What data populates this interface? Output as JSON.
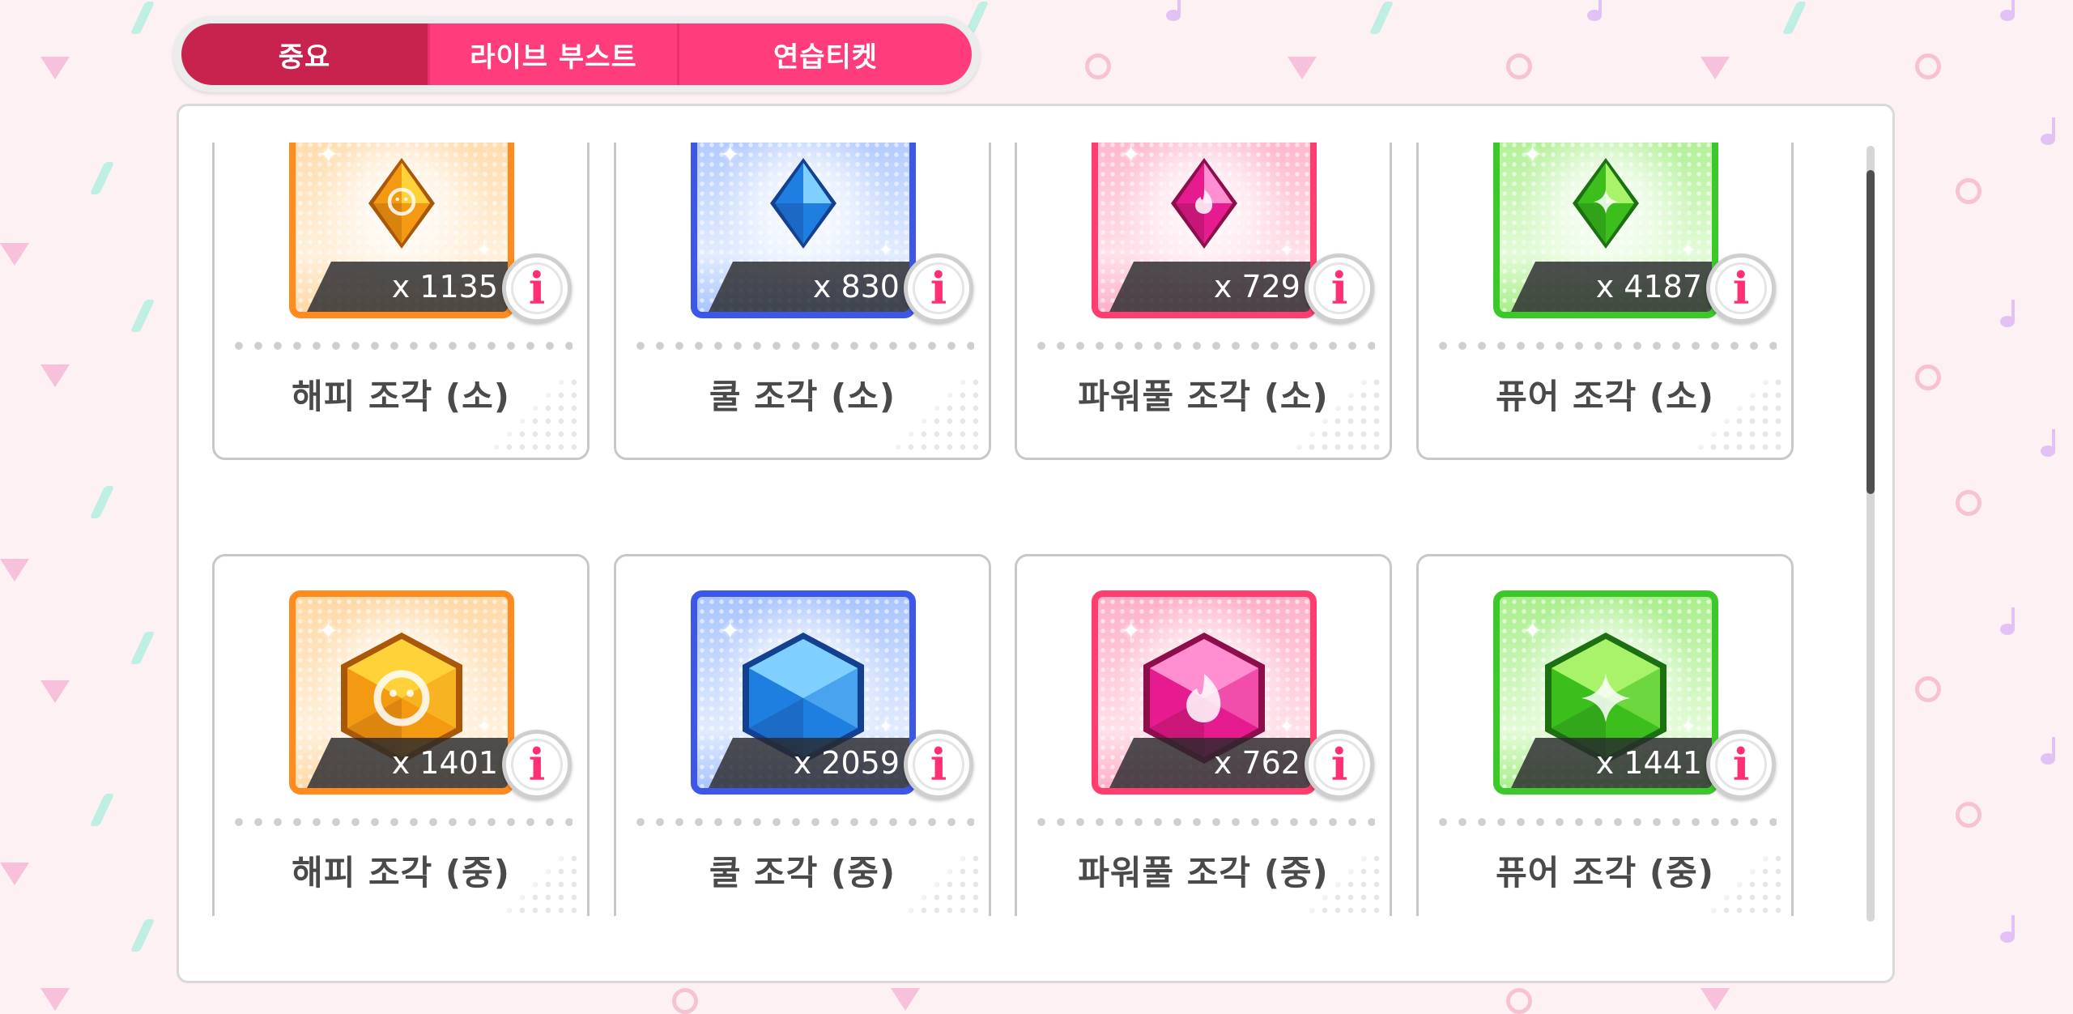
{
  "tabs": [
    {
      "label": "중요",
      "active": true
    },
    {
      "label": "라이브 부스트",
      "active": false
    },
    {
      "label": "연습티켓",
      "active": false
    }
  ],
  "items": [
    {
      "name": "해피 조각 (소)",
      "qty": "x 1135",
      "attribute": "happy",
      "size": "small",
      "color": "#ff8a1e",
      "gem_icon": "smiley-diamond-icon"
    },
    {
      "name": "쿨 조각 (소)",
      "qty": "x 830",
      "attribute": "cool",
      "size": "small",
      "color": "#3d57e8",
      "gem_icon": "moon-diamond-icon"
    },
    {
      "name": "파워풀 조각 (소)",
      "qty": "x 729",
      "attribute": "powerful",
      "size": "small",
      "color": "#ff3d6e",
      "gem_icon": "flame-diamond-icon"
    },
    {
      "name": "퓨어 조각 (소)",
      "qty": "x 4187",
      "attribute": "pure",
      "size": "small",
      "color": "#3cc82a",
      "gem_icon": "sparkle-diamond-icon"
    },
    {
      "name": "해피 조각 (중)",
      "qty": "x 1401",
      "attribute": "happy",
      "size": "medium",
      "color": "#ff8a1e",
      "gem_icon": "smiley-hexagon-icon"
    },
    {
      "name": "쿨 조각 (중)",
      "qty": "x 2059",
      "attribute": "cool",
      "size": "medium",
      "color": "#3d57e8",
      "gem_icon": "moon-hexagon-icon"
    },
    {
      "name": "파워풀 조각 (중)",
      "qty": "x 762",
      "attribute": "powerful",
      "size": "medium",
      "color": "#ff3d6e",
      "gem_icon": "flame-hexagon-icon"
    },
    {
      "name": "퓨어 조각 (중)",
      "qty": "x 1441",
      "attribute": "pure",
      "size": "medium",
      "color": "#3cc82a",
      "gem_icon": "sparkle-hexagon-icon"
    }
  ],
  "info_icon_label": "i",
  "colors": {
    "tab_active": "#c8224f",
    "tab_inactive": "#ff3d7c",
    "info_accent": "#ff2f73"
  }
}
